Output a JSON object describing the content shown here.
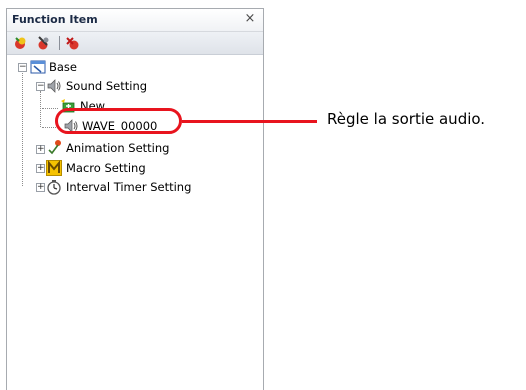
{
  "panel": {
    "title": "Function Item",
    "close_glyph": "×"
  },
  "toolbar": {
    "buttons": [
      {
        "icon": "add-function-icon"
      },
      {
        "icon": "edit-function-icon"
      },
      {
        "icon": "delete-function-icon"
      }
    ]
  },
  "tree": {
    "root": {
      "label": "Base",
      "icon": "base-screen-icon",
      "expander": "−"
    },
    "sound_setting": {
      "label": "Sound Setting",
      "icon": "speaker-icon",
      "expander": "−"
    },
    "new_item": {
      "label": "New",
      "icon": "new-item-icon"
    },
    "wave_item": {
      "label": "WAVE_00000",
      "icon": "speaker-icon"
    },
    "animation_setting": {
      "label": "Animation Setting",
      "icon": "animation-icon",
      "expander": "+"
    },
    "macro_setting": {
      "label": "Macro Setting",
      "icon": "macro-m-icon",
      "expander": "+"
    },
    "interval_timer_setting": {
      "label": "Interval Timer Setting",
      "icon": "timer-icon",
      "expander": "+"
    }
  },
  "callout": {
    "text": "Règle la sortie audio.",
    "color": "#e8141e"
  }
}
